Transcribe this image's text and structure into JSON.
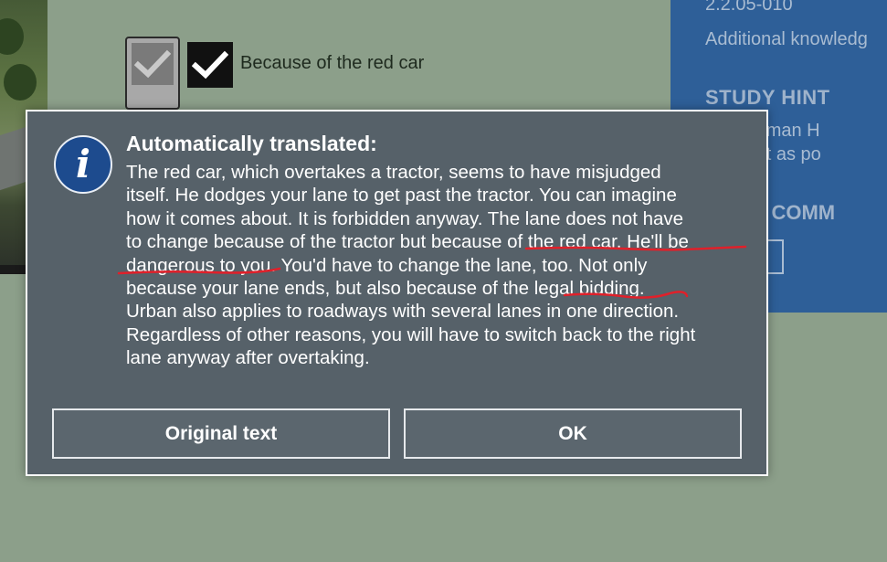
{
  "background": {
    "answer_text": "Because of the red car",
    "side_panel": {
      "code": "2.2.05-010",
      "extra": "Additional knowledg",
      "hint_title": "STUDY HINT",
      "hint_lines": [
        "the German H",
        "the right as po"
      ],
      "teacher_title": "HER'S COMM"
    }
  },
  "dialog": {
    "title": "Automatically translated:",
    "icon": "info-icon",
    "body_lines": [
      "The red car, which overtakes a tractor, seems to have misjudged",
      "itself. He dodges your lane to get past the tractor. You can imagine",
      "how it comes about. It is forbidden anyway. The lane does not have",
      "to change because of the tractor but because of the red car. He'll be",
      "dangerous to you. You'd have to change the lane, too. Not only",
      "because your lane ends, but also because of the legal bidding.",
      "Urban also applies to roadways with several lanes in one direction.",
      "Regardless of other reasons, you will have to switch back to the right",
      "lane anyway after overtaking."
    ],
    "buttons": {
      "original_label": "Original text",
      "ok_label": "OK"
    }
  },
  "colors": {
    "dialog_bg": "#566169",
    "dialog_border": "#ffffff",
    "info_icon_bg": "#1d4b8e",
    "side_panel_bg": "#2e5f98",
    "page_bg": "#8c9f8a",
    "underline": "#e0202a"
  }
}
